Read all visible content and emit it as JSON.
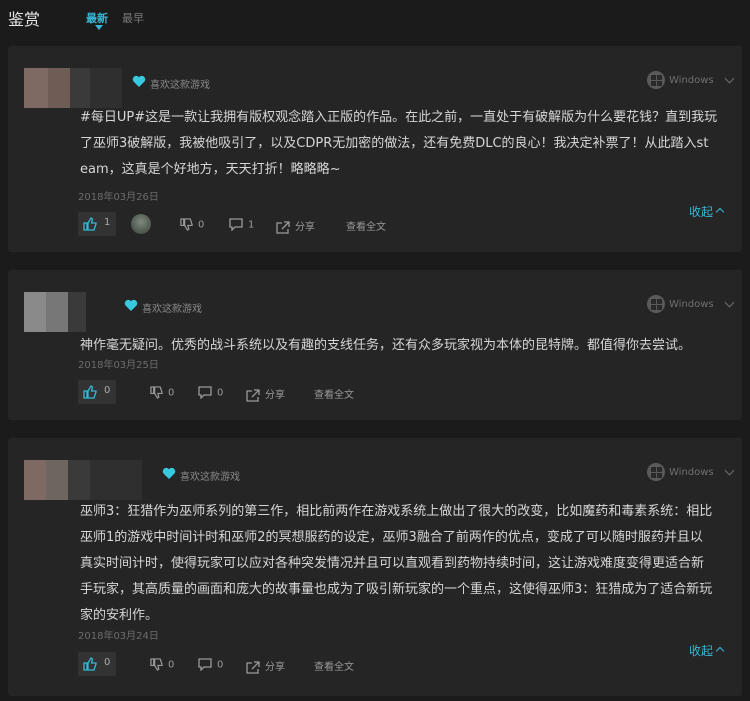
{
  "header": {
    "title": "鉴赏",
    "tabs": [
      {
        "label": "最新",
        "active": true
      },
      {
        "label": "最早",
        "active": false
      }
    ],
    "accent_color": "#36b9d6"
  },
  "reviews": [
    {
      "recommend": "喜欢这款游戏",
      "platform": "Windows",
      "text": [
        "#每日UP#这是一款让我拥有版权观念踏入正版的作品。在此之前，一直处于有破解版为什么要花钱？直到我玩",
        "了巫师3破解版，我被他吸引了，以及CDPR无加密的做法，还有免费DLC的良心！我决定补票了！从此踏入st",
        "eam，这真是个好地方，天天打折！略略略~"
      ],
      "date": "2018年03月26日",
      "likes": "1",
      "dislikes": "0",
      "comments": "1",
      "share": "分享",
      "view_full": "查看全文",
      "collapse": "收起"
    },
    {
      "recommend": "喜欢这款游戏",
      "platform": "Windows",
      "text": [
        "神作毫无疑问。优秀的战斗系统以及有趣的支线任务，还有众多玩家视为本体的昆特牌。都值得你去尝试。"
      ],
      "date": "2018年03月25日",
      "likes": "0",
      "dislikes": "0",
      "comments": "0",
      "share": "分享",
      "view_full": "查看全文"
    },
    {
      "recommend": "喜欢这款游戏",
      "platform": "Windows",
      "text": [
        "巫师3：狂猎作为巫师系列的第三作，相比前两作在游戏系统上做出了很大的改变，比如魔药和毒素系统：相比",
        "巫师1的游戏中时间计时和巫师2的冥想服药的设定，巫师3融合了前两作的优点，变成了可以随时服药并且以",
        "真实时间计时，使得玩家可以应对各种突发情况并且可以直观看到药物持续时间，这让游戏难度变得更适合新",
        "手玩家，其高质量的画面和庞大的故事量也成为了吸引新玩家的一个重点，这使得巫师3：狂猎成为了适合新玩",
        "家的安利作。"
      ],
      "date": "2018年03月24日",
      "likes": "0",
      "dislikes": "0",
      "comments": "0",
      "share": "分享",
      "view_full": "查看全文",
      "collapse": "收起"
    }
  ]
}
